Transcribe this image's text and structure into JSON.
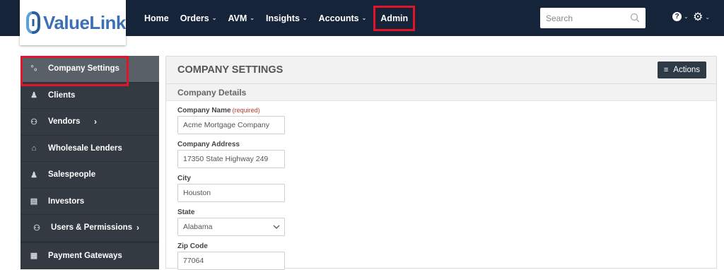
{
  "brand": {
    "name": "ValueLink"
  },
  "nav": {
    "items": [
      {
        "label": "Home",
        "caret": false
      },
      {
        "label": "Orders",
        "caret": true
      },
      {
        "label": "AVM",
        "caret": true
      },
      {
        "label": "Insights",
        "caret": true
      },
      {
        "label": "Accounts",
        "caret": true
      },
      {
        "label": "Admin",
        "caret": false
      }
    ]
  },
  "search": {
    "placeholder": "Search"
  },
  "utility": {
    "help_glyph": "?",
    "settings_glyph": "⚙"
  },
  "sidebar": {
    "items": [
      {
        "label": "Company Settings",
        "icon": "settings-dots-icon"
      },
      {
        "label": "Clients",
        "icon": "person-icon"
      },
      {
        "label": "Vendors",
        "icon": "people-icon"
      },
      {
        "label": "Wholesale Lenders",
        "icon": "bank-icon"
      },
      {
        "label": "Salespeople",
        "icon": "person-icon"
      },
      {
        "label": "Investors",
        "icon": "investors-icon"
      },
      {
        "label": "Users & Permissions",
        "icon": "people-icon"
      },
      {
        "label": "Payment Gateways",
        "icon": "grid-icon"
      }
    ]
  },
  "panel": {
    "title": "COMPANY SETTINGS",
    "actions_label": "Actions",
    "section": "Company Details"
  },
  "form": {
    "company_name": {
      "label": "Company Name",
      "required": "(required)",
      "value": "Acme Mortgage Company"
    },
    "company_address": {
      "label": "Company Address",
      "value": "17350 State Highway 249"
    },
    "city": {
      "label": "City",
      "value": "Houston"
    },
    "state": {
      "label": "State",
      "value": "Alabama"
    },
    "zip": {
      "label": "Zip Code",
      "value": "77064"
    }
  },
  "colors": {
    "nav_bg": "#16243a",
    "sidebar_bg": "#333a42",
    "highlight": "#e3132a",
    "brand_blue": "#3b6fb6"
  }
}
